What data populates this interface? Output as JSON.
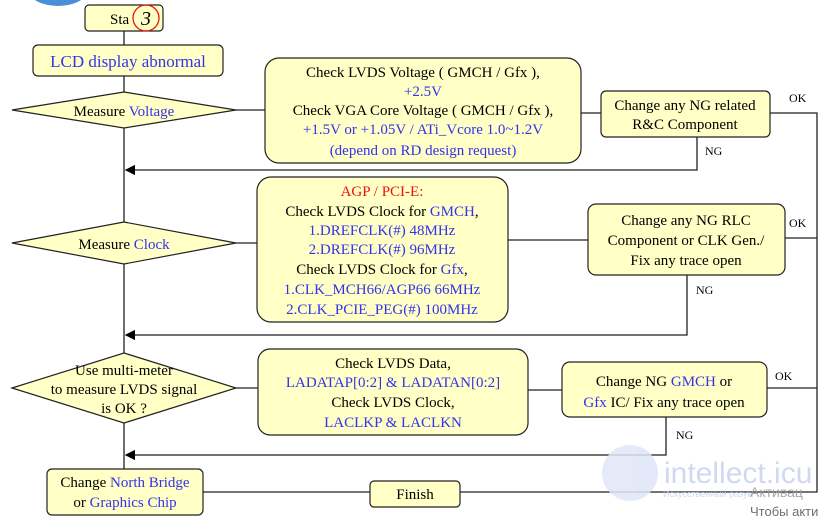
{
  "start": {
    "label": "Sta",
    "step_number": "3"
  },
  "problem": "LCD display abnormal",
  "decisions": {
    "voltage": {
      "prefix": "Measure ",
      "highlight": "Voltage"
    },
    "clock": {
      "prefix": "Measure ",
      "highlight": "Clock"
    },
    "lvds": {
      "lines": [
        "Use multi-meter",
        "to measure LVDS signal",
        "is OK ?"
      ]
    }
  },
  "voltage_box": {
    "line1": "Check LVDS Voltage ( GMCH / Gfx ),",
    "line2": "+2.5V",
    "line3": "Check VGA Core Voltage ( GMCH / Gfx ),",
    "line4": "+1.5V or +1.05V / ATi_Vcore 1.0~1.2V",
    "line5": "(depend on RD design request)"
  },
  "clock_box": {
    "line1": "AGP / PCI-E:",
    "line2_prefix": "Check LVDS Clock for ",
    "line2_highlight": "GMCH",
    "line2_suffix": ",",
    "line3": "1.DREFCLK(#) 48MHz",
    "line4": "2.DREFCLK(#) 96MHz",
    "line5_prefix": "Check LVDS Clock for ",
    "line5_highlight": "Gfx",
    "line5_suffix": ",",
    "line6": "1.CLK_MCH66/AGP66  66MHz",
    "line7": "2.CLK_PCIE_PEG(#)  100MHz"
  },
  "data_box": {
    "line1": "Check LVDS Data,",
    "line2": "LADATAP[0:2] & LADATAN[0:2]",
    "line3": "Check LVDS Clock,",
    "line4": "LACLKP & LACLKN"
  },
  "actions": {
    "rc": [
      "Change any NG related",
      "R&C Component"
    ],
    "rlc": [
      "Change any NG RLC",
      "Component or CLK Gen./",
      "Fix any trace open"
    ],
    "gmch": {
      "prefix": "Change NG ",
      "highlight1": "GMCH",
      "mid": " or",
      "highlight2": "Gfx",
      "suffix": " IC/ Fix any trace open"
    }
  },
  "change_chip": {
    "prefix": "Change ",
    "highlight1": "North Bridge",
    "line2_prefix": "or ",
    "highlight2": "Graphics Chip"
  },
  "finish": "Finish",
  "edge_labels": {
    "ok": "OK",
    "ng": "NG"
  },
  "watermark": {
    "brand": "intellect.icu",
    "tagline": "Искусственный разум",
    "windows_line1": "Активац",
    "windows_line2": "Чтобы акти"
  },
  "colors": {
    "box_fill": "#ffffc6",
    "accent_text": "#3333ee",
    "red": "#ee1111"
  }
}
